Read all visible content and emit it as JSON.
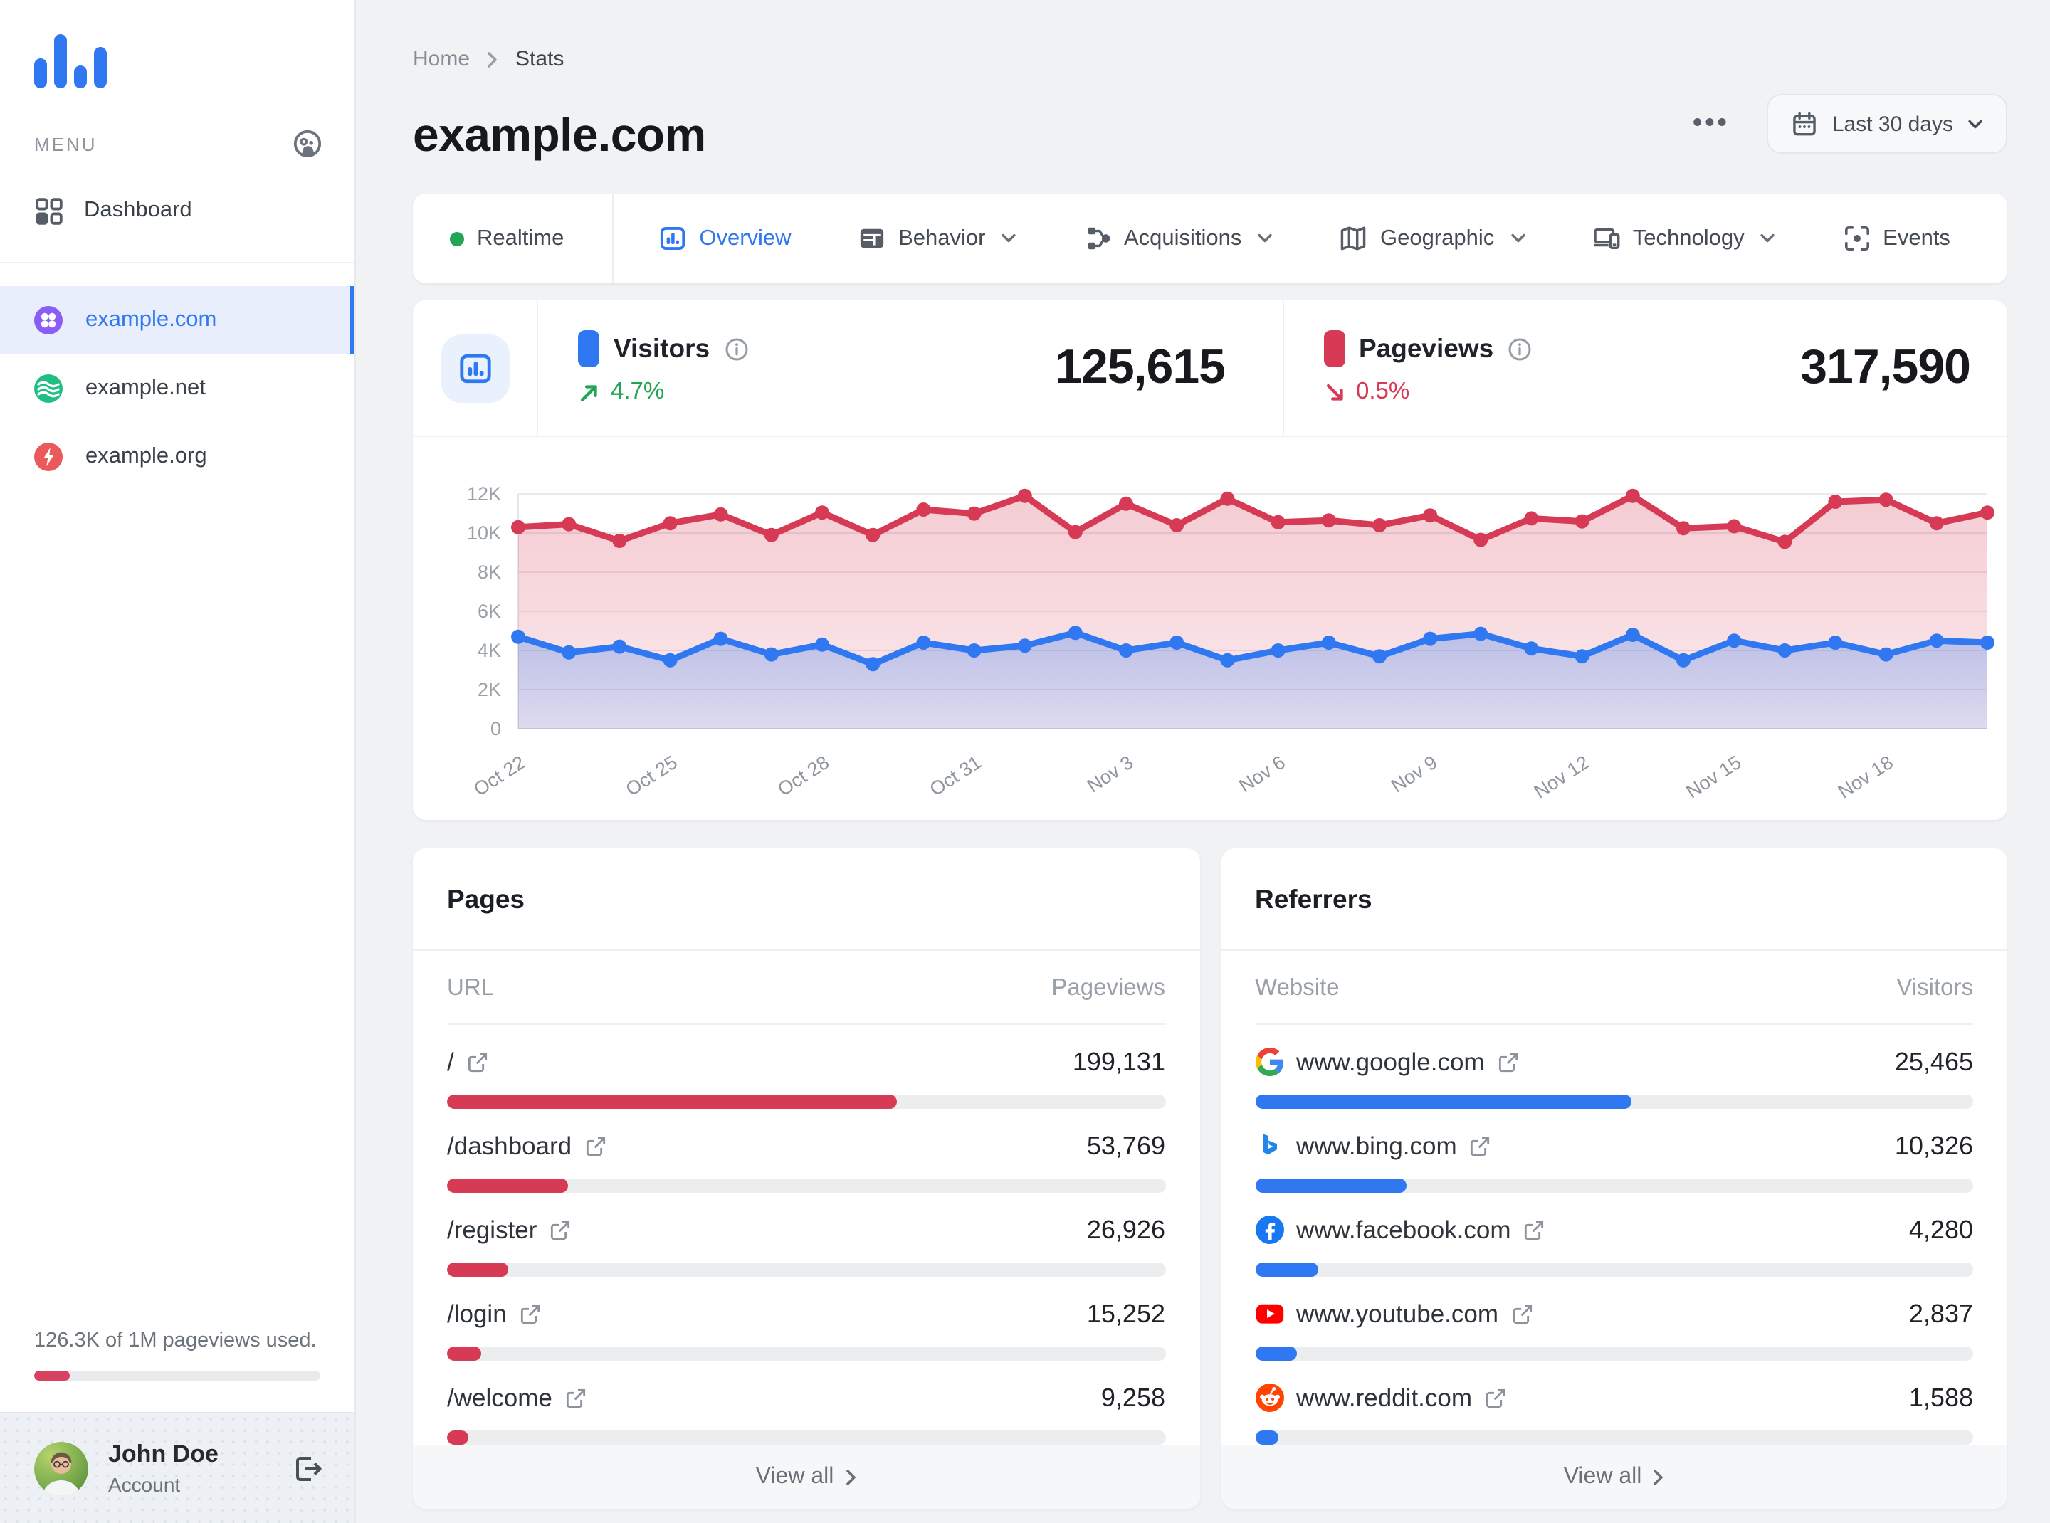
{
  "colors": {
    "accent_blue": "#2f78f2",
    "crimson": "#d63a54",
    "green": "#21a453"
  },
  "sidebar": {
    "menu_label": "MENU",
    "nav": {
      "dashboard": "Dashboard"
    },
    "sites": [
      {
        "label": "example.com",
        "icon": "clover-site-icon",
        "color": "#8b5cf6",
        "active": true
      },
      {
        "label": "example.net",
        "icon": "waves-site-icon",
        "color": "#1fbf83",
        "active": false
      },
      {
        "label": "example.org",
        "icon": "bolt-site-icon",
        "color": "#ea5a5a",
        "active": false
      }
    ],
    "usage": {
      "text": "126.3K of 1M pageviews used.",
      "percent": 12.6
    },
    "account": {
      "name": "John Doe",
      "role": "Account"
    }
  },
  "header": {
    "breadcrumb": {
      "home": "Home",
      "current": "Stats"
    },
    "title": "example.com",
    "more_label": "•••",
    "date_button": {
      "label": "Last 30 days"
    }
  },
  "tabs": [
    {
      "label": "Realtime",
      "icon": "realtime-dot",
      "active": false,
      "chevron": false
    },
    {
      "label": "Overview",
      "icon": "overview-chart-icon",
      "active": true,
      "chevron": false
    },
    {
      "label": "Behavior",
      "icon": "behavior-panels-icon",
      "active": false,
      "chevron": true
    },
    {
      "label": "Acquisitions",
      "icon": "acquisitions-branch-icon",
      "active": false,
      "chevron": true
    },
    {
      "label": "Geographic",
      "icon": "geographic-map-icon",
      "active": false,
      "chevron": true
    },
    {
      "label": "Technology",
      "icon": "technology-devices-icon",
      "active": false,
      "chevron": true
    },
    {
      "label": "Events",
      "icon": "events-target-icon",
      "active": false,
      "chevron": false
    }
  ],
  "stats": {
    "visitors": {
      "label": "Visitors",
      "value": "125,615",
      "change": "4.7%",
      "direction": "up",
      "marker_color": "#2f78f2"
    },
    "pageviews": {
      "label": "Pageviews",
      "value": "317,590",
      "change": "0.5%",
      "direction": "down",
      "marker_color": "#d63a54"
    }
  },
  "chart_data": {
    "type": "area",
    "x": [
      "Oct 22",
      "Oct 23",
      "Oct 24",
      "Oct 25",
      "Oct 26",
      "Oct 27",
      "Oct 28",
      "Oct 29",
      "Oct 30",
      "Oct 31",
      "Nov 1",
      "Nov 2",
      "Nov 3",
      "Nov 4",
      "Nov 5",
      "Nov 6",
      "Nov 7",
      "Nov 8",
      "Nov 9",
      "Nov 10",
      "Nov 11",
      "Nov 12",
      "Nov 13",
      "Nov 14",
      "Nov 15",
      "Nov 16",
      "Nov 17",
      "Nov 18",
      "Nov 19",
      "Nov 20"
    ],
    "x_tick_labels": [
      "Oct 22",
      "Oct 25",
      "Oct 28",
      "Oct 31",
      "Nov 3",
      "Nov 6",
      "Nov 9",
      "Nov 12",
      "Nov 15",
      "Nov 18"
    ],
    "x_tick_every": 3,
    "y_ticks": [
      "0",
      "2K",
      "4K",
      "6K",
      "8K",
      "10K",
      "12K"
    ],
    "ylim": [
      0,
      12000
    ],
    "grid": true,
    "legend_position": "in-stats-row",
    "series": [
      {
        "name": "Pageviews",
        "color": "#d63a54",
        "values": [
          10300,
          10450,
          9600,
          10500,
          10950,
          9900,
          11050,
          9900,
          11200,
          11000,
          11900,
          10050,
          11500,
          10400,
          11750,
          10550,
          10650,
          10400,
          10900,
          9650,
          10750,
          10600,
          11900,
          10250,
          10350,
          9550,
          11600,
          11700,
          10500,
          11050
        ]
      },
      {
        "name": "Visitors",
        "color": "#2f78f2",
        "values": [
          4700,
          3900,
          4200,
          3500,
          4600,
          3800,
          4300,
          3300,
          4400,
          4000,
          4250,
          4900,
          4000,
          4400,
          3500,
          4000,
          4400,
          3700,
          4600,
          4850,
          4100,
          3700,
          4800,
          3500,
          4500,
          4000,
          4400,
          3800,
          4500,
          4400
        ]
      }
    ]
  },
  "pages_card": {
    "title": "Pages",
    "columns": [
      "URL",
      "Pageviews"
    ],
    "bar_color": "#d63a54",
    "rows": [
      {
        "url": "/",
        "value": "199,131",
        "bar_percent": 62.7
      },
      {
        "url": "/dashboard",
        "value": "53,769",
        "bar_percent": 16.9
      },
      {
        "url": "/register",
        "value": "26,926",
        "bar_percent": 8.5
      },
      {
        "url": "/login",
        "value": "15,252",
        "bar_percent": 4.8
      },
      {
        "url": "/welcome",
        "value": "9,258",
        "bar_percent": 2.9
      }
    ],
    "view_all": "View all"
  },
  "referrers_card": {
    "title": "Referrers",
    "columns": [
      "Website",
      "Visitors"
    ],
    "bar_color": "#2f78f2",
    "rows": [
      {
        "website": "www.google.com",
        "icon": "google-favicon",
        "value": "25,465",
        "bar_percent": 52.4
      },
      {
        "website": "www.bing.com",
        "icon": "bing-favicon",
        "value": "10,326",
        "bar_percent": 21.2
      },
      {
        "website": "www.facebook.com",
        "icon": "facebook-favicon",
        "value": "4,280",
        "bar_percent": 8.8
      },
      {
        "website": "www.youtube.com",
        "icon": "youtube-favicon",
        "value": "2,837",
        "bar_percent": 5.8
      },
      {
        "website": "www.reddit.com",
        "icon": "reddit-favicon",
        "value": "1,588",
        "bar_percent": 3.3
      }
    ],
    "view_all": "View all"
  }
}
